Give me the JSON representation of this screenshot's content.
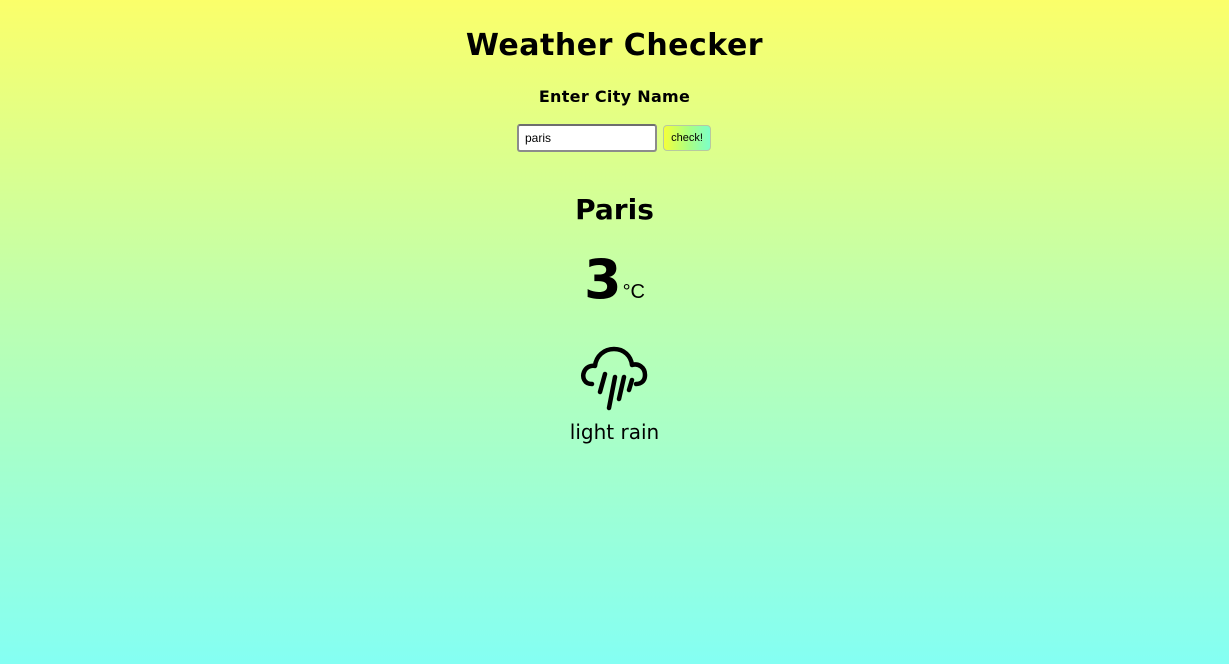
{
  "app": {
    "title": "Weather Checker",
    "city_label": "Enter City Name"
  },
  "search": {
    "value": "paris",
    "button_label": "check!"
  },
  "result": {
    "city": "Paris",
    "temperature": "3",
    "unit": "°C",
    "icon": "rain-cloud-icon",
    "description": "light rain"
  },
  "colors": {
    "gradient_top": "#fbff6a",
    "gradient_bottom": "#84fff3"
  }
}
